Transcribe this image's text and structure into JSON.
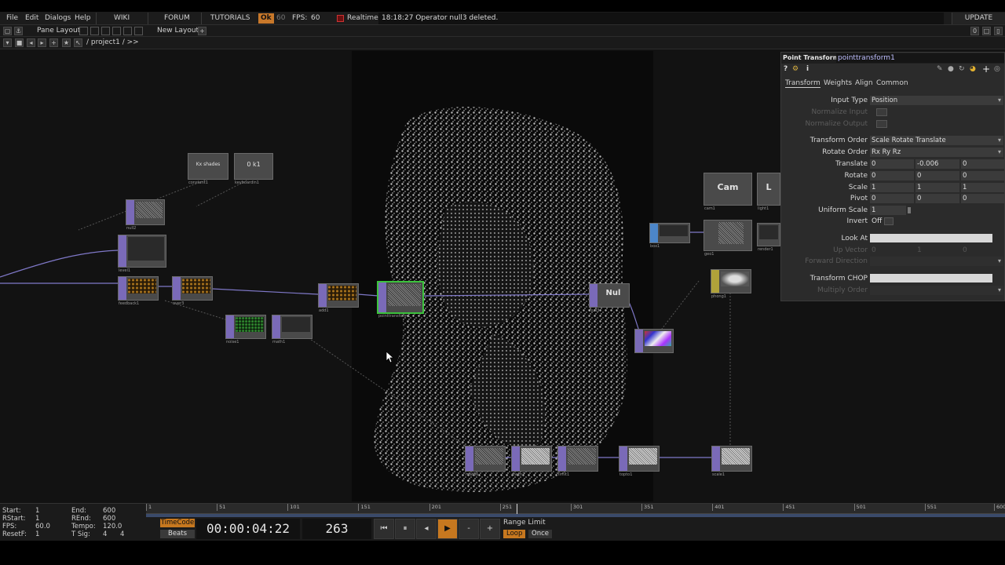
{
  "menu": {
    "items": [
      "File",
      "Edit",
      "Dialogs",
      "Help"
    ],
    "links": [
      "WIKI",
      "FORUM",
      "TUTORIALS"
    ],
    "ok_badge": "Ok",
    "fps_dim": "60",
    "fps_label": "FPS:",
    "fps_value": "60",
    "realtime_label": "Realtime",
    "message": "18:18:27 Operator null3 deleted.",
    "update_label": "UPDATE"
  },
  "panebar": {
    "pane_layout_label": "Pane Layout",
    "new_layout_label": "New Layout",
    "add_glyph": "+",
    "counter": "0"
  },
  "pathbar": {
    "path": "/ project1 / >>"
  },
  "nodes": {
    "constant_label": "constant1",
    "constant_text": "Kx shades",
    "keyboard_label": "keyboardin1",
    "keyboard_text": "0 k1",
    "null2_label": "null2",
    "level_label": "level1",
    "feedback_label": "feedback1",
    "over_label": "over3",
    "noise_label": "noise1",
    "math_label": "math1",
    "add_label": "add1",
    "pt_label": "pointtransform1",
    "null_label": "null3",
    "null_text": "Nul",
    "camera_label": "cam1",
    "camera_text": "Cam",
    "light_label": "light1",
    "light_text": "L",
    "geo_label": "geo1",
    "box_label": "box1",
    "render_label": "render1",
    "phong_label": "phong1",
    "colour_label": "",
    "bottom_labels": [
      "math6",
      "math7",
      "limit1",
      "topto1",
      "scale1"
    ]
  },
  "params": {
    "op_type": "Point Transform",
    "op_name": "pointtransform1",
    "tabs": [
      "Transform",
      "Weights",
      "Align",
      "Common"
    ],
    "input_type_label": "Input Type",
    "input_type_value": "Position",
    "normalize_input_label": "Normalize Input",
    "normalize_output_label": "Normalize Output",
    "transform_order_label": "Transform Order",
    "transform_order_value": "Scale Rotate Translate",
    "rotate_order_label": "Rotate Order",
    "rotate_order_value": "Rx Ry Rz",
    "translate_label": "Translate",
    "translate": [
      "0",
      "-0.006",
      "0"
    ],
    "rotate_label": "Rotate",
    "rotate": [
      "0",
      "0",
      "0"
    ],
    "scale_label": "Scale",
    "scale": [
      "1",
      "1",
      "1"
    ],
    "pivot_label": "Pivot",
    "pivot": [
      "0",
      "0",
      "0"
    ],
    "uniform_scale_label": "Uniform Scale",
    "uniform_scale_value": "1",
    "invert_label": "Invert",
    "invert_value": "Off",
    "look_at_label": "Look At",
    "up_vector_label": "Up Vector",
    "up_vector": [
      "0",
      "1",
      "0"
    ],
    "forward_label": "Forward Direction",
    "transform_chop_label": "Transform CHOP",
    "multiply_order_label": "Multiply Order"
  },
  "timeline": {
    "start_label": "Start:",
    "start": "1",
    "end_label": "End:",
    "end": "600",
    "rstart_label": "RStart:",
    "rstart": "1",
    "rend_label": "REnd:",
    "rend": "600",
    "fps_label": "FPS:",
    "fps": "60.0",
    "tempo_label": "Tempo:",
    "tempo": "120.0",
    "resetf_label": "ResetF:",
    "resetf": "1",
    "tsig_label": "T Sig:",
    "tsig_a": "4",
    "tsig_b": "4",
    "ticks": [
      "1",
      "51",
      "101",
      "151",
      "201",
      "251",
      "301",
      "351",
      "401",
      "451",
      "501",
      "551",
      "600"
    ],
    "timecode_btn": "TimeCode",
    "beats_btn": "Beats",
    "timecode": "00:00:04:22",
    "frame": "263",
    "range_limit_label": "Range Limit",
    "loop_label": "Loop",
    "once_label": "Once",
    "transport": [
      "⏮",
      "⏸",
      "◂",
      "▶",
      "-",
      "+"
    ],
    "current_frame": 263,
    "total_frames": 600
  }
}
